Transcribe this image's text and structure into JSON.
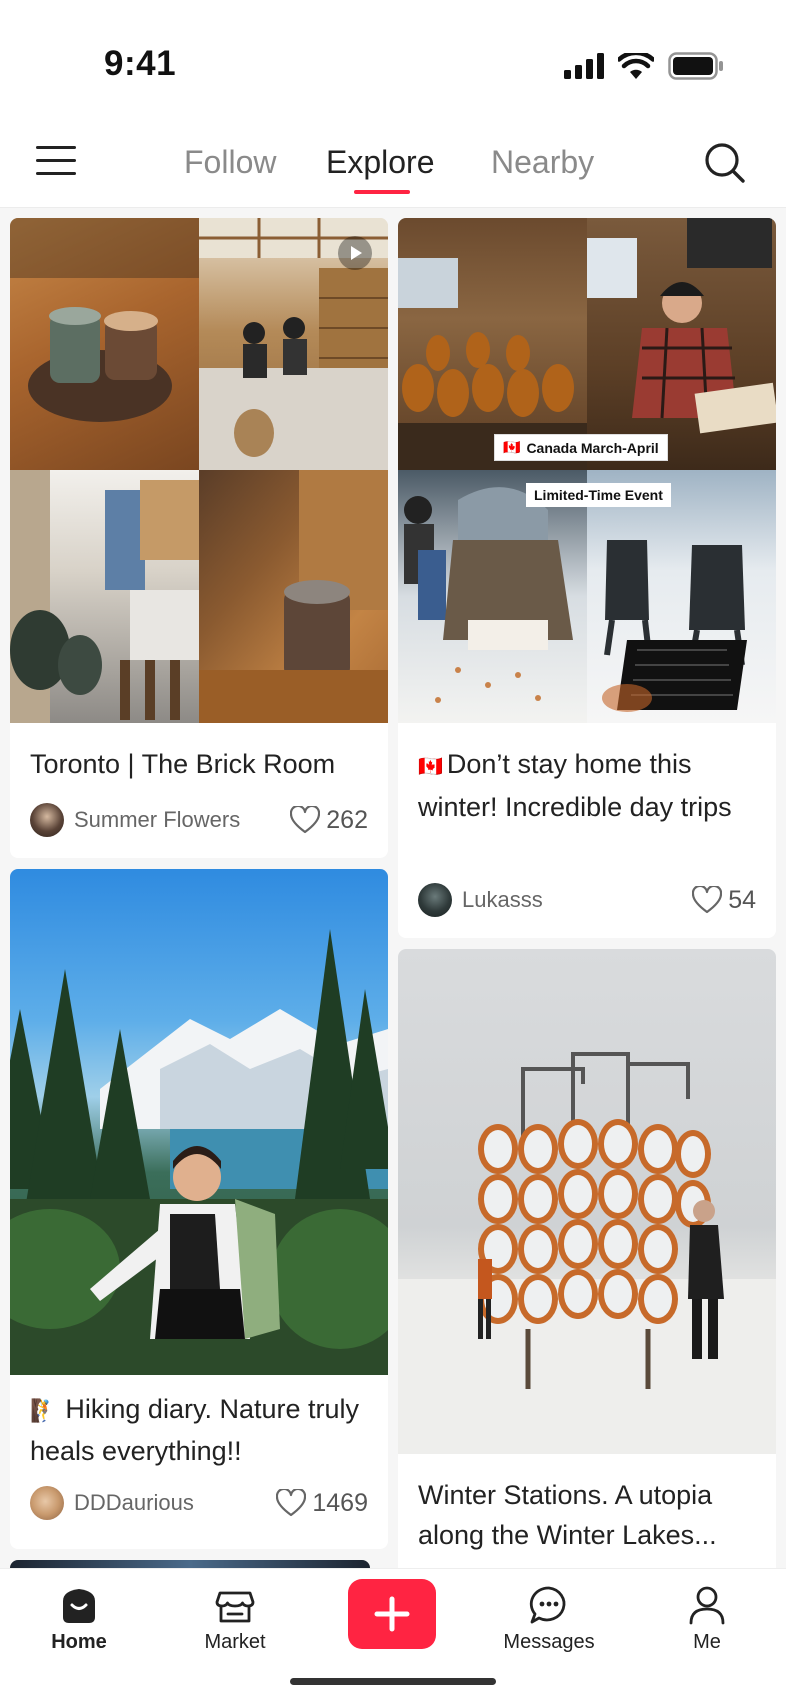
{
  "status": {
    "time": "9:41"
  },
  "nav": {
    "tabs": [
      {
        "label": "Follow",
        "active": false
      },
      {
        "label": "Explore",
        "active": true
      },
      {
        "label": "Nearby",
        "active": false
      }
    ]
  },
  "feed": {
    "left": [
      {
        "title": "Toronto | The Brick Room",
        "author": "Summer Flowers",
        "likes": "262",
        "has_video": true
      },
      {
        "title_emoji": "🧗",
        "title": "Hiking diary. Nature truly heals everything!!",
        "author": "DDDaurious",
        "likes": "1469"
      }
    ],
    "right": [
      {
        "title_emoji": "🇨🇦",
        "title": "Don’t stay home this winter! Incredible day trips",
        "author": "Lukasss",
        "likes": "54",
        "tag_top": "Canada March-April",
        "tag_top_flag": "🇨🇦",
        "tag_bottom": "Limited-Time Event"
      },
      {
        "title": "Winter Stations. A utopia along the Winter Lakes..."
      }
    ]
  },
  "bottom_nav": {
    "items": [
      {
        "label": "Home",
        "icon": "home-icon",
        "active": true
      },
      {
        "label": "Market",
        "icon": "market-icon",
        "active": false
      },
      {
        "label": "Messages",
        "icon": "messages-icon",
        "active": false
      },
      {
        "label": "Me",
        "icon": "me-icon",
        "active": false
      }
    ]
  },
  "colors": {
    "accent": "#ff2442",
    "text": "#222222",
    "muted": "#8a8a8a"
  }
}
